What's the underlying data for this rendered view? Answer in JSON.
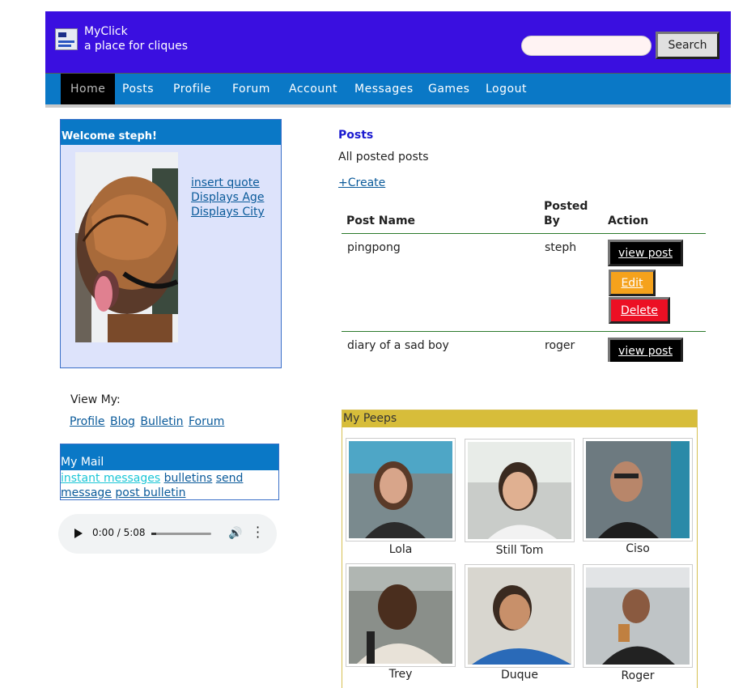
{
  "header": {
    "brand_name": "MyClick",
    "tagline": "a place for cliques",
    "search_placeholder": "",
    "search_button": "Search",
    "bg_color": "#3a0fe0"
  },
  "nav": {
    "items": [
      "Home",
      "Posts",
      "Profile",
      "Forum",
      "Account",
      "Messages",
      "Games",
      "Logout"
    ],
    "active": "Home",
    "bg_color": "#0a78c6"
  },
  "welcome": {
    "title": "Welcome steph!",
    "links": [
      "insert quote",
      "Displays Age",
      "Displays City"
    ]
  },
  "view_my": {
    "label": "View My:",
    "links": [
      "Profile",
      "Blog",
      "Bulletin",
      "Forum"
    ]
  },
  "mail": {
    "title": "My Mail",
    "links": [
      "instant messages",
      "bulletins",
      "send message",
      "post bulletin"
    ]
  },
  "audio": {
    "time": "0:00 / 5:08"
  },
  "posts": {
    "title": "Posts",
    "subtitle": "All posted posts",
    "create": "+Create",
    "columns": [
      "Post Name",
      "Posted By",
      "Action"
    ],
    "rows": [
      {
        "name": "pingpong",
        "by": "steph",
        "actions": [
          "view post",
          "Edit",
          "Delete"
        ]
      },
      {
        "name": "diary of a sad boy",
        "by": "roger",
        "actions": [
          "view post"
        ]
      }
    ]
  },
  "peeps": {
    "title": "My Peeps",
    "people": [
      "Lola",
      "Still Tom",
      "Ciso",
      "Trey",
      "Duque",
      "Roger"
    ]
  }
}
